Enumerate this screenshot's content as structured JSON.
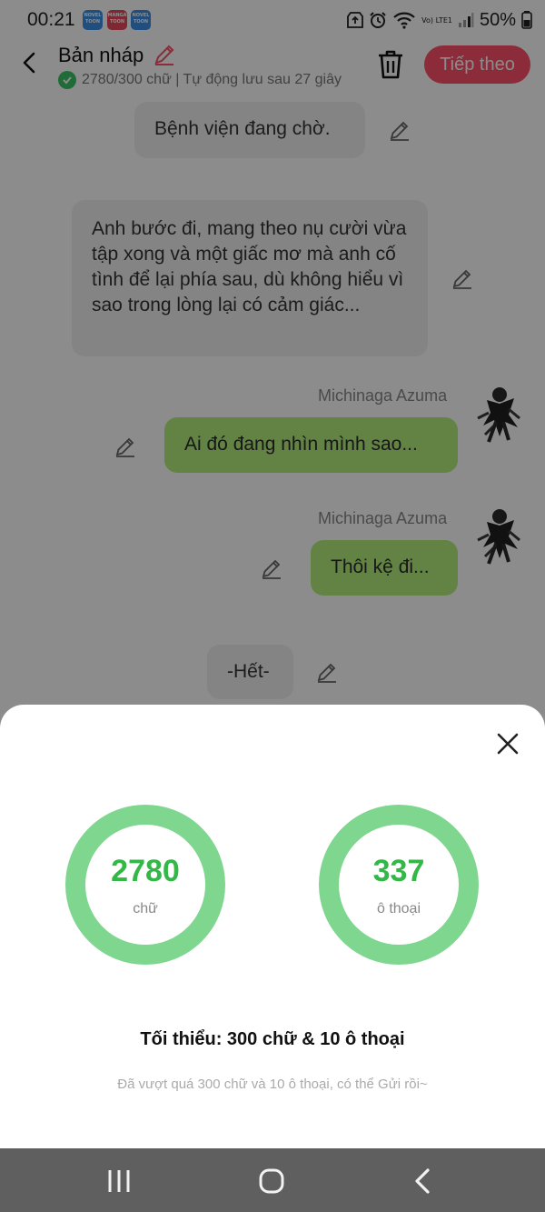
{
  "status_bar": {
    "time": "00:21",
    "badges": [
      {
        "label": "NOVEL TOON",
        "color": "#3b8fe8"
      },
      {
        "label": "MANGA TOON",
        "color": "#e84a5f"
      },
      {
        "label": "NOVEL TOON",
        "color": "#3b8fe8"
      }
    ],
    "network_label": "Vo) LTE1",
    "battery": "50%",
    "icons": [
      "upload-icon",
      "alarm-icon",
      "wifi-icon",
      "signal-icon",
      "battery-icon"
    ]
  },
  "header": {
    "title": "Bản nháp",
    "meta": "2780/300 chữ | Tự động lưu sau 27 giây",
    "next_label": "Tiếp theo",
    "accent": "#ff4f6b"
  },
  "chat": {
    "messages": [
      {
        "type": "narration",
        "text": "Bệnh viện đang chờ."
      },
      {
        "type": "narration",
        "text": "Anh bước đi, mang theo nụ cười vừa tập xong và một giấc mơ mà anh cố tình để lại phía sau, dù không hiểu vì sao trong lòng lại có cảm giác..."
      },
      {
        "type": "dialog",
        "speaker": "Michinaga Azuma",
        "text": "Ai đó đang nhìn mình sao..."
      },
      {
        "type": "dialog",
        "speaker": "Michinaga Azuma",
        "text": "Thôi kệ đi..."
      },
      {
        "type": "narration",
        "text": "-Hết-"
      }
    ]
  },
  "sheet": {
    "words": {
      "value": "2780",
      "unit": "chữ"
    },
    "dialogs": {
      "value": "337",
      "unit": "ô thoại"
    },
    "minimum": "Tối thiểu: 300 chữ & 10 ô thoại",
    "hint": "Đã vượt quá 300 chữ và 10 ô thoại, có thể Gửi rồi~",
    "ring_color": "#7fd68f",
    "value_color": "#33b847"
  },
  "nav": {
    "icons": [
      "recent-apps-icon",
      "home-icon",
      "back-icon"
    ]
  }
}
